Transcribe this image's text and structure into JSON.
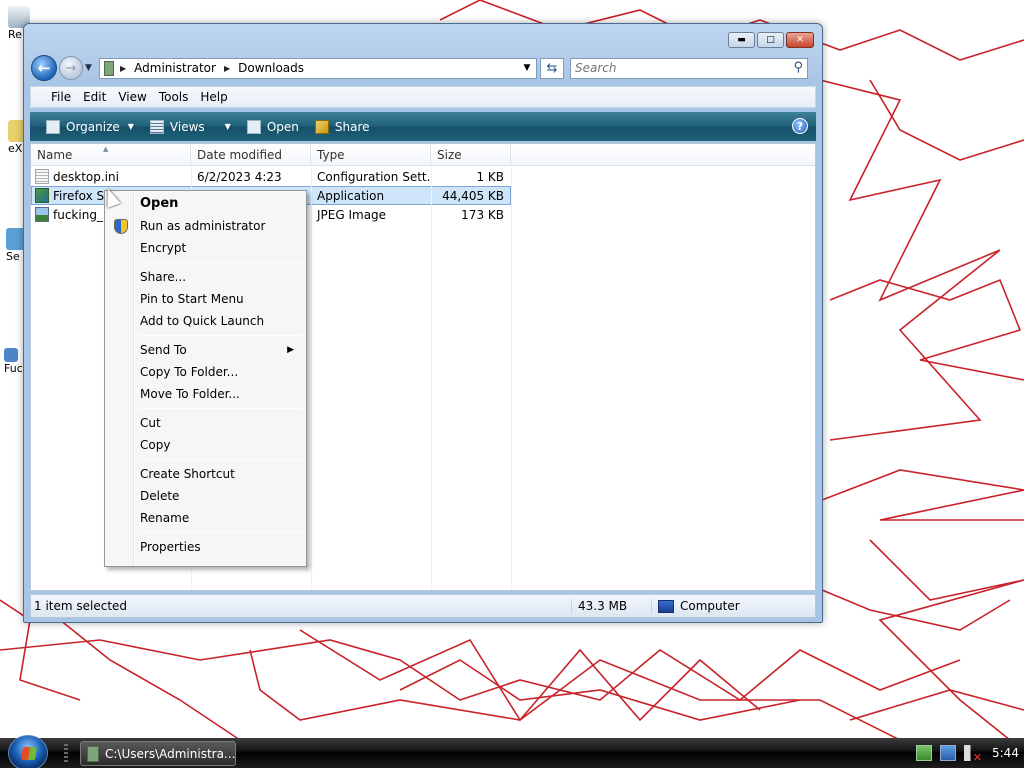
{
  "window": {
    "address": {
      "crumbs": [
        "Administrator",
        "Downloads"
      ]
    },
    "search": {
      "placeholder": "Search"
    },
    "menu": [
      "File",
      "Edit",
      "View",
      "Tools",
      "Help"
    ],
    "toolbar": {
      "organize": "Organize",
      "views": "Views",
      "open": "Open",
      "share": "Share",
      "help": "?"
    },
    "columns": [
      "Name",
      "Date modified",
      "Type",
      "Size"
    ],
    "files": [
      {
        "name": "desktop.ini",
        "date": "6/2/2023 4:23",
        "type": "Configuration Sett...",
        "size": "1 KB",
        "icon": "ini-file-icon"
      },
      {
        "name": "Firefox Se",
        "date": "",
        "type": "Application",
        "size": "44,405 KB",
        "icon": "application-icon"
      },
      {
        "name": "fucking_",
        "date": "",
        "type": "JPEG Image",
        "size": "173 KB",
        "icon": "jpeg-file-icon"
      }
    ],
    "status": {
      "selection": "1 item selected",
      "size": "43.3 MB",
      "location": "Computer"
    }
  },
  "context_menu": {
    "open": "Open",
    "run_as_admin": "Run as administrator",
    "encrypt": "Encrypt",
    "share": "Share...",
    "pin_start": "Pin to Start Menu",
    "quick_launch": "Add to Quick Launch",
    "send_to": "Send To",
    "copy_to_folder": "Copy To Folder...",
    "move_to_folder": "Move To Folder...",
    "cut": "Cut",
    "copy": "Copy",
    "create_shortcut": "Create Shortcut",
    "delete": "Delete",
    "rename": "Rename",
    "properties": "Properties"
  },
  "desktop": {
    "labels": [
      "Re",
      "eX",
      "Se",
      "Fuc"
    ]
  },
  "taskbar": {
    "task": "C:\\Users\\Administra...",
    "clock": "5:44"
  },
  "colors": {
    "selection": "#cfe6fa",
    "toolbar": "#1f5f78",
    "wallpaper_lines": "#c8222a"
  }
}
